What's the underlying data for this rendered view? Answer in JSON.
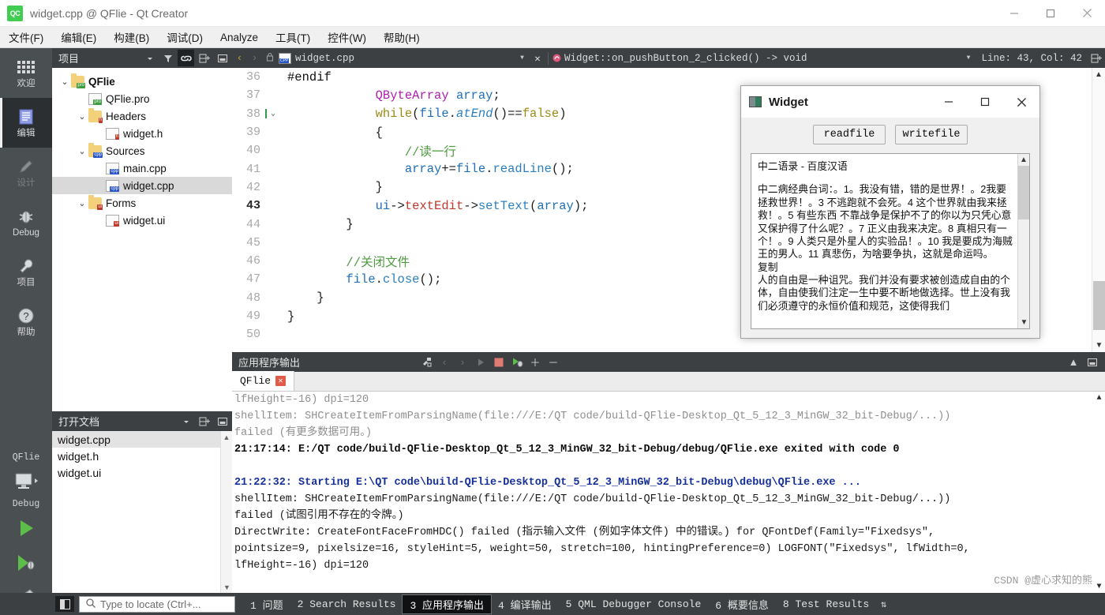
{
  "window": {
    "title": "widget.cpp @ QFlie - Qt Creator",
    "logo_text": "QC",
    "minimize": "–",
    "maximize": "□",
    "close": "✕"
  },
  "menubar": {
    "items": [
      {
        "label": "文件(F)",
        "name": "menu-file"
      },
      {
        "label": "编辑(E)",
        "name": "menu-edit"
      },
      {
        "label": "构建(B)",
        "name": "menu-build"
      },
      {
        "label": "调试(D)",
        "name": "menu-debug"
      },
      {
        "label": "Analyze",
        "name": "menu-analyze"
      },
      {
        "label": "工具(T)",
        "name": "menu-tools"
      },
      {
        "label": "控件(W)",
        "name": "menu-widgets"
      },
      {
        "label": "帮助(H)",
        "name": "menu-help"
      }
    ]
  },
  "activitybar": {
    "items": [
      {
        "label": "欢迎",
        "name": "sidebar-item-welcome",
        "active": false
      },
      {
        "label": "编辑",
        "name": "sidebar-item-edit",
        "active": true
      },
      {
        "label": "设计",
        "name": "sidebar-item-design",
        "active": false
      },
      {
        "label": "Debug",
        "name": "sidebar-item-debug",
        "active": false
      },
      {
        "label": "项目",
        "name": "sidebar-item-projects",
        "active": false
      },
      {
        "label": "帮助",
        "name": "sidebar-item-help",
        "active": false
      }
    ],
    "kit_name": "QFlie",
    "build_config": "Debug"
  },
  "project_panel": {
    "title": "项目",
    "tree": [
      {
        "label": "QFlie",
        "level": 1,
        "twisty": "⌄",
        "icon": "folder",
        "badge": "pro",
        "bold": true,
        "selected": false
      },
      {
        "label": "QFlie.pro",
        "level": 2,
        "twisty": "",
        "icon": "doc",
        "badge": "pro",
        "bold": false,
        "selected": false
      },
      {
        "label": "Headers",
        "level": 2,
        "twisty": "⌄",
        "icon": "folder",
        "badge": "h",
        "bold": false,
        "selected": false
      },
      {
        "label": "widget.h",
        "level": 3,
        "twisty": "",
        "icon": "doc",
        "badge": "h",
        "bold": false,
        "selected": false
      },
      {
        "label": "Sources",
        "level": 2,
        "twisty": "⌄",
        "icon": "folder",
        "badge": "cpp",
        "bold": false,
        "selected": false
      },
      {
        "label": "main.cpp",
        "level": 3,
        "twisty": "",
        "icon": "doc",
        "badge": "cpp",
        "bold": false,
        "selected": false
      },
      {
        "label": "widget.cpp",
        "level": 3,
        "twisty": "",
        "icon": "doc",
        "badge": "cpp",
        "bold": false,
        "selected": true
      },
      {
        "label": "Forms",
        "level": 2,
        "twisty": "⌄",
        "icon": "folder",
        "badge": "ui",
        "bold": false,
        "selected": false
      },
      {
        "label": "widget.ui",
        "level": 3,
        "twisty": "",
        "icon": "doc",
        "badge": "ui",
        "bold": false,
        "selected": false
      }
    ]
  },
  "open_documents": {
    "title": "打开文档",
    "items": [
      {
        "label": "widget.cpp",
        "selected": true
      },
      {
        "label": "widget.h",
        "selected": false
      },
      {
        "label": "widget.ui",
        "selected": false
      }
    ]
  },
  "editor_toolbar": {
    "file_name": "widget.cpp",
    "symbol": "Widget::on_pushButton_2_clicked() -> void",
    "line_col": "Line: 43, Col: 42",
    "close_label": "✕"
  },
  "editor": {
    "lines": [
      {
        "num": "36",
        "fold": "",
        "current": false
      },
      {
        "num": "37",
        "fold": "",
        "current": false
      },
      {
        "num": "38",
        "fold": "⌄",
        "current": false
      },
      {
        "num": "39",
        "fold": "",
        "current": false
      },
      {
        "num": "40",
        "fold": "",
        "current": false
      },
      {
        "num": "41",
        "fold": "",
        "current": false
      },
      {
        "num": "42",
        "fold": "",
        "current": false
      },
      {
        "num": "43",
        "fold": "",
        "current": true
      },
      {
        "num": "44",
        "fold": "",
        "current": false
      },
      {
        "num": "45",
        "fold": "",
        "current": false
      },
      {
        "num": "46",
        "fold": "",
        "current": false
      },
      {
        "num": "47",
        "fold": "",
        "current": false
      },
      {
        "num": "48",
        "fold": "",
        "current": false
      },
      {
        "num": "49",
        "fold": "",
        "current": false
      },
      {
        "num": "50",
        "fold": "",
        "current": false
      }
    ],
    "code": [
      "#endif",
      "            QByteArray array;",
      "            while(file.atEnd()==false)",
      "            {",
      "                //读一行",
      "                array+=file.readLine();",
      "            }",
      "            ui->textEdit->setText(array);",
      "        }",
      "",
      "        //关闭文件",
      "        file.close();",
      "    }",
      "}",
      ""
    ]
  },
  "output_panel": {
    "title": "应用程序输出",
    "tab_label": "QFlie",
    "lines": [
      {
        "text": "lfHeight=-16) dpi=120",
        "style": "o-gray"
      },
      {
        "text": "shellItem: SHCreateItemFromParsingName(file:///E:/QT code/build-QFlie-Desktop_Qt_5_12_3_MinGW_32_bit-Debug/...))",
        "style": "o-gray"
      },
      {
        "text": "failed (有更多数据可用。)",
        "style": "o-gray"
      },
      {
        "text": "21:17:14: E:/QT code/build-QFlie-Desktop_Qt_5_12_3_MinGW_32_bit-Debug/debug/QFlie.exe exited with code 0",
        "style": "o-dark"
      },
      {
        "text": "",
        "style": "o-norm"
      },
      {
        "text": "21:22:32: Starting E:\\QT code\\build-QFlie-Desktop_Qt_5_12_3_MinGW_32_bit-Debug\\debug\\QFlie.exe ...",
        "style": "o-blue"
      },
      {
        "text": "shellItem: SHCreateItemFromParsingName(file:///E:/QT code/build-QFlie-Desktop_Qt_5_12_3_MinGW_32_bit-Debug/...))",
        "style": "o-norm"
      },
      {
        "text": "failed (试图引用不存在的令牌。)",
        "style": "o-norm"
      },
      {
        "text": "DirectWrite: CreateFontFaceFromHDC() failed (指示输入文件 (例如字体文件) 中的错误。) for QFontDef(Family=\"Fixedsys\",",
        "style": "o-norm"
      },
      {
        "text": "pointsize=9, pixelsize=16, styleHint=5, weight=50, stretch=100, hintingPreference=0) LOGFONT(\"Fixedsys\", lfWidth=0,",
        "style": "o-norm"
      },
      {
        "text": "lfHeight=-16) dpi=120",
        "style": "o-norm"
      }
    ]
  },
  "statusbar": {
    "locate_placeholder": "Type to locate (Ctrl+...",
    "tabs": [
      {
        "label": "1 问题",
        "name": "statusbar-tab-issues",
        "active": false
      },
      {
        "label": "2 Search Results",
        "name": "statusbar-tab-search-results",
        "active": false
      },
      {
        "label": "3 应用程序输出",
        "name": "statusbar-tab-application-output",
        "active": true
      },
      {
        "label": "4 编译输出",
        "name": "statusbar-tab-compile-output",
        "active": false
      },
      {
        "label": "5 QML Debugger Console",
        "name": "statusbar-tab-qml-debugger-console",
        "active": false
      },
      {
        "label": "6 概要信息",
        "name": "statusbar-tab-general-messages",
        "active": false
      },
      {
        "label": "8 Test Results",
        "name": "statusbar-tab-test-results",
        "active": false
      }
    ],
    "more_arrows": "⇅"
  },
  "dialog": {
    "title": "Widget",
    "minimize": "—",
    "maximize": "□",
    "close": "✕",
    "buttons": [
      {
        "label": "readfile",
        "name": "readfile-button"
      },
      {
        "label": "writefile",
        "name": "writefile-button"
      }
    ],
    "text_content": {
      "heading": "中二语录 - 百度汉语",
      "paragraph1": "中二病经典台词：。1。我没有错，错的是世界！。2我要拯救世界！。3 不逃跑就不会死。4 这个世界就由我来拯救！。5 有些东西 不靠战争是保护不了的你以为只凭心意 又保护得了什么呢？。7 正义由我来决定。8 真相只有一个！。9 人类只是外星人的实验品！。10 我是要成为海贼王的男人。11 真悲伤，为啥要争执，这就是命运吗。",
      "paragraph2": "复制",
      "paragraph3": "人的自由是一种诅咒。我们并没有要求被创造成自由的个体，自由使我们注定一生中要不断地做选择。世上没有我们必须遵守的永恒价值和规范，这使得我们"
    }
  },
  "watermark": {
    "text": "CSDN @虚心求知的熊"
  },
  "colors": {
    "panel_dark": "#3c4042",
    "activity_bar": "#4a4f52",
    "accent_green": "#41cd52",
    "selection": "#d9d9d9",
    "output_blue": "#16309a"
  }
}
